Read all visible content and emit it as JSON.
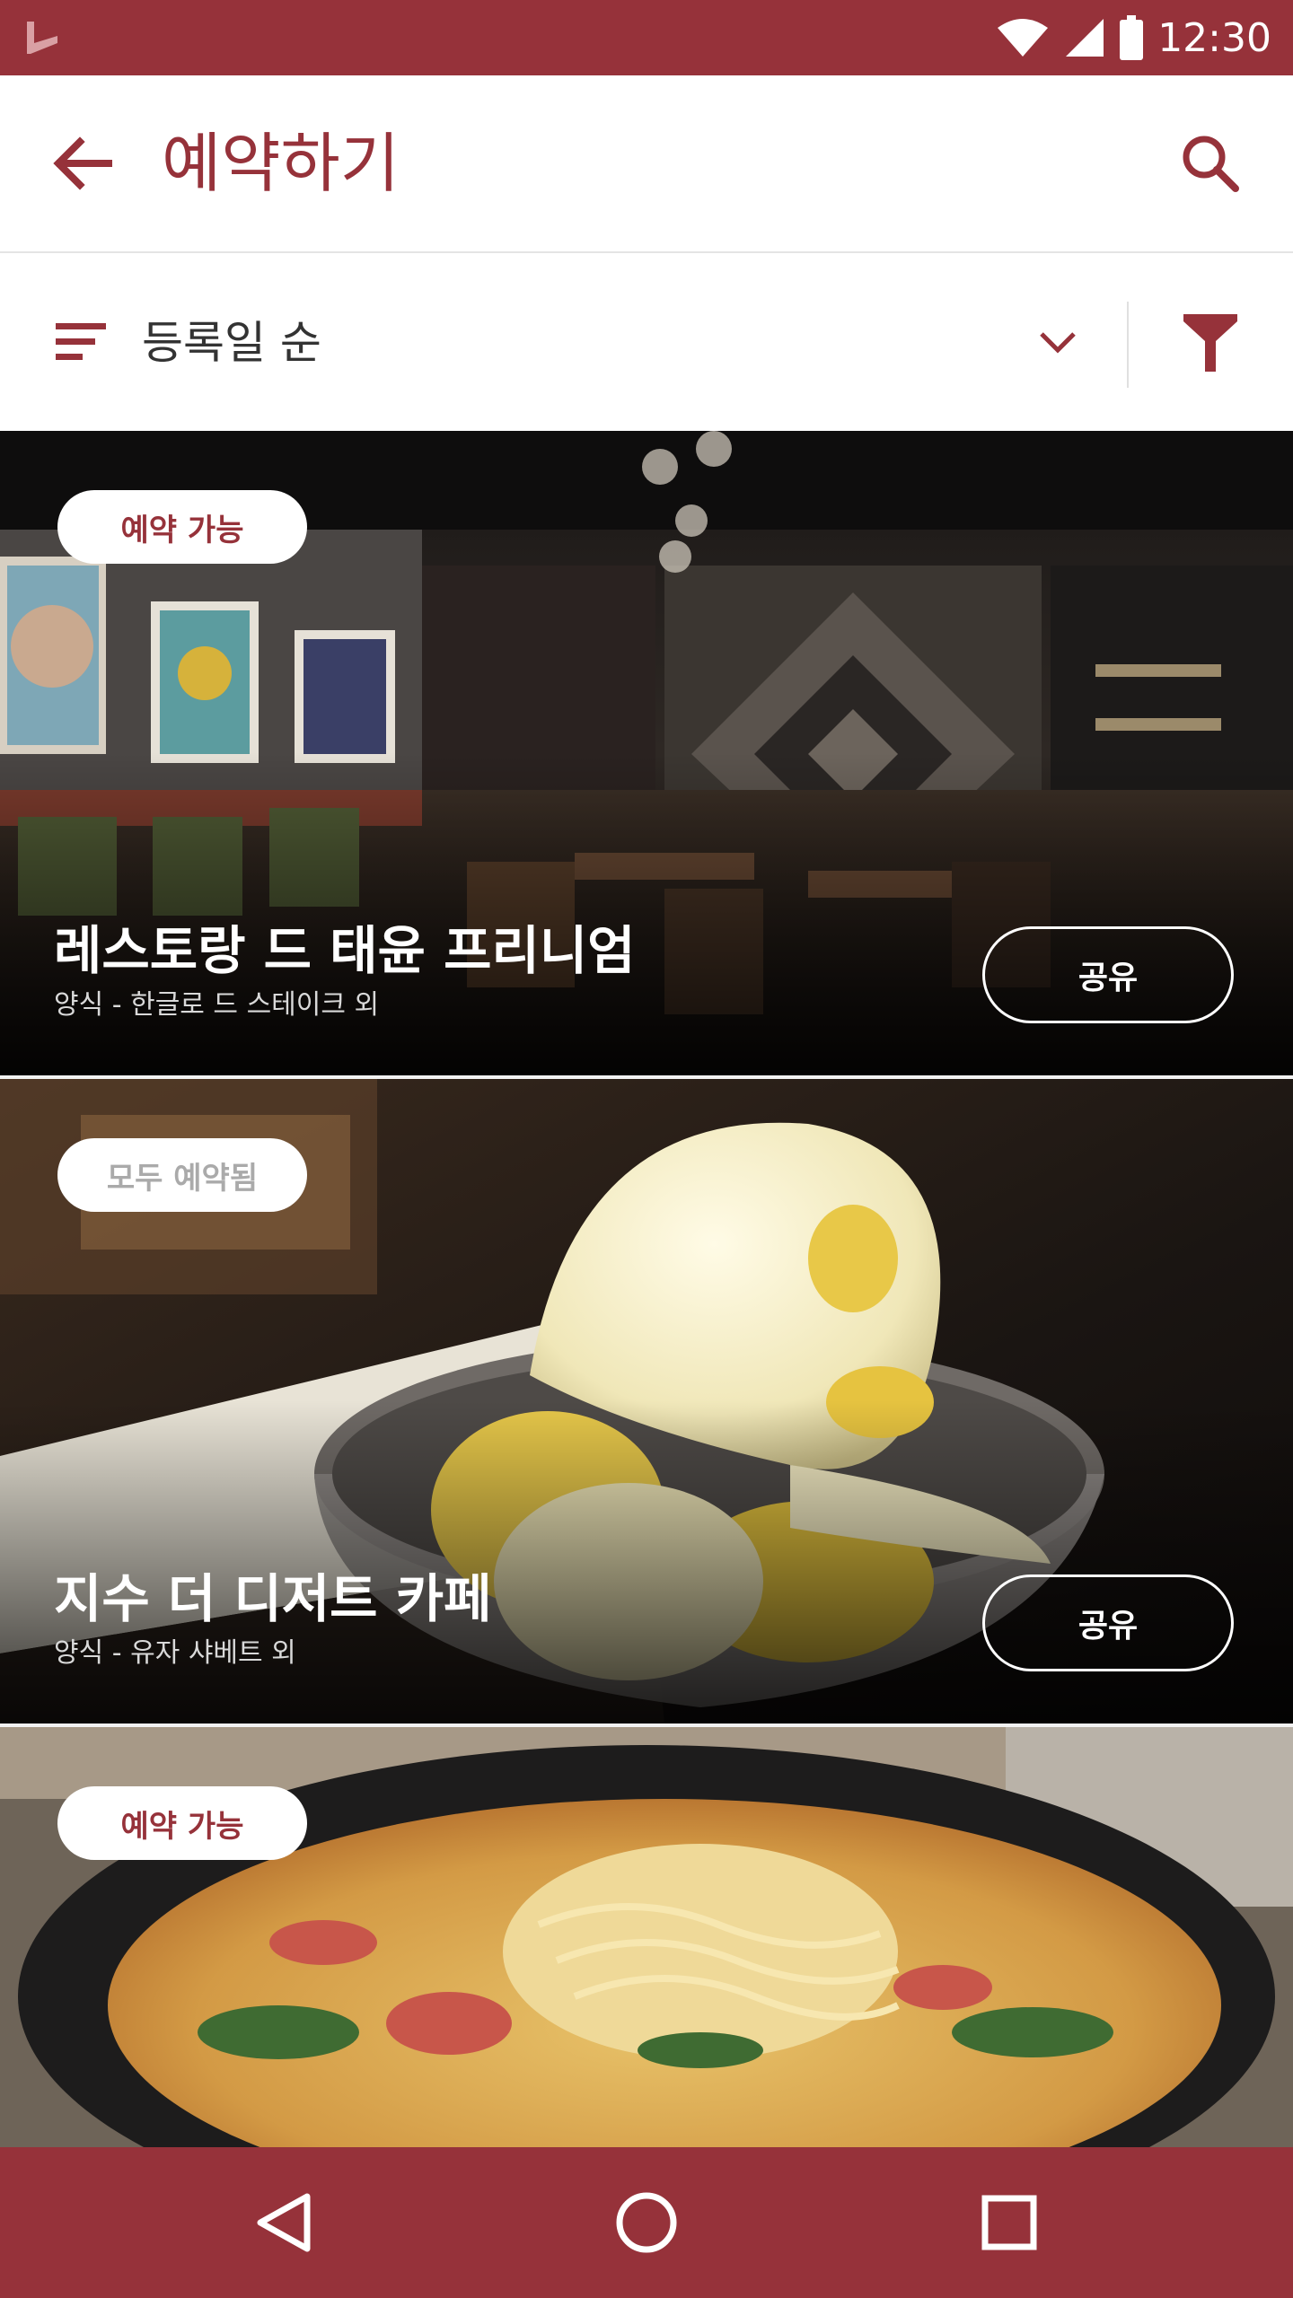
{
  "status_bar": {
    "time": "12:30"
  },
  "app_bar": {
    "title": "예약하기"
  },
  "sort_bar": {
    "label": "등록일 순"
  },
  "cards": [
    {
      "badge": "예약 가능",
      "title": "레스토랑 드 태윤 프리니엄",
      "subtitle": "양식 - 한글로 드 스테이크 외",
      "share": "공유"
    },
    {
      "badge": "모두 예약됨",
      "title": "지수 더 디저트 카페",
      "subtitle": "양식 - 유자 샤베트 외",
      "share": "공유"
    },
    {
      "badge": "예약 가능"
    }
  ],
  "colors": {
    "brand": "#96323a",
    "status_badge_available": "#96323a",
    "status_badge_full": "#aaaaaa"
  }
}
